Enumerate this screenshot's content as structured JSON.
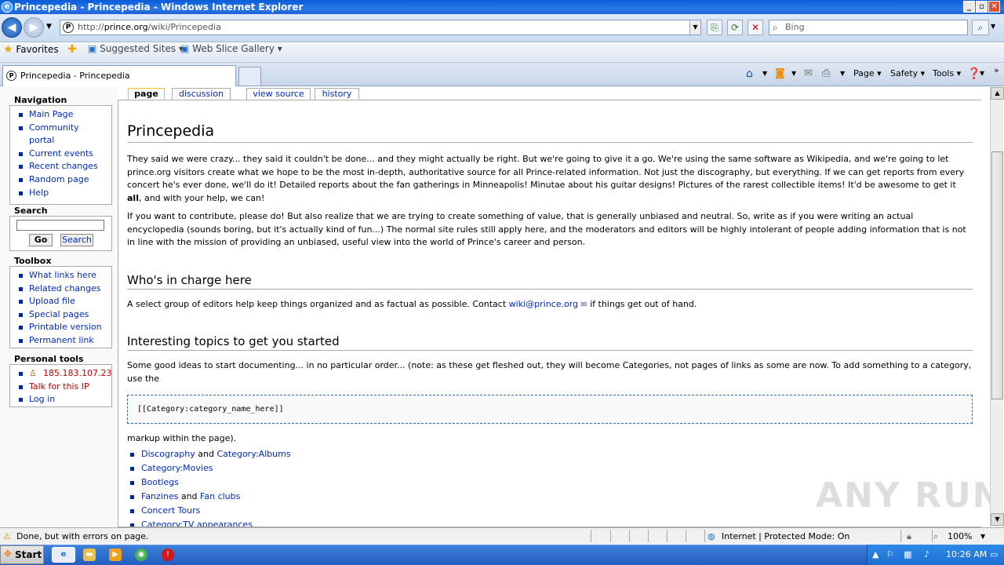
{
  "window": {
    "title": "Princepedia - Princepedia - Windows Internet Explorer"
  },
  "address": {
    "prefix": "http://",
    "host": "prince.org",
    "path": "/wiki/Princepedia"
  },
  "search": {
    "placeholder": "Bing"
  },
  "favorites": {
    "label": "Favorites",
    "items": [
      "Suggested Sites",
      "Web Slice Gallery"
    ]
  },
  "tab": {
    "title": "Princepedia - Princepedia"
  },
  "commands": {
    "page": "Page",
    "safety": "Safety",
    "tools": "Tools"
  },
  "content_tabs": [
    "page",
    "discussion",
    "view source",
    "history"
  ],
  "sidebar": {
    "navigation": {
      "title": "Navigation",
      "items": [
        "Main Page",
        "Community",
        "portal",
        "Current events",
        "Recent changes",
        "Random page",
        "Help"
      ]
    },
    "search": {
      "title": "Search",
      "go": "Go",
      "search": "Search"
    },
    "toolbox": {
      "title": "Toolbox",
      "items": [
        "What links here",
        "Related changes",
        "Upload file",
        "Special pages",
        "Printable version",
        "Permanent link"
      ]
    },
    "personal": {
      "title": "Personal tools",
      "items": [
        "185.183.107.23",
        "Talk for this IP",
        "Log in"
      ]
    }
  },
  "article": {
    "title": "Princepedia",
    "p1a": "They said we were crazy... they said it couldn't be done... and they might actually be right. But we're going to give it a go. We're using the same software as Wikipedia, and we're going to let prince.org visitors create what we hope to be the most in-depth, authoritative source for all Prince-related information. Not just the discography, but everything. If we can get reports from every concert he's ever done, we'll do it! Detailed reports about the fan gatherings in Minneapolis! Minutae about his guitar designs! Pictures of the rarest collectible items! It'd be awesome to get it ",
    "p1b": "all",
    "p1c": ", and with your help, we can!",
    "p2": "If you want to contribute, please do! But also realize that we are trying to create something of value, that is generally unbiased and neutral. So, write as if you were writing an actual encyclopedia (sounds boring, but it's actually kind of fun...) The normal site rules still apply here, and the moderators and editors will be highly intolerant of people adding information that is not in line with the mission of providing an unbiased, useful view into the world of Prince's career and person.",
    "h2a": "Who's in charge here",
    "p3a": "A select group of editors help keep things organized and as factual as possible. Contact ",
    "p3link": "wiki@prince.org",
    "p3b": " if things get out of hand.",
    "h2b": "Interesting topics to get you started",
    "p4": "Some good ideas to start documenting... in no particular order... (note: as these get fleshed out, they will become Categories, not pages of links as some are now. To add something to a category, use the",
    "pre": "[[Category:category_name_here]]",
    "p5": "markup within the page).",
    "topics": [
      {
        "a": "Discography",
        "and": " and ",
        "b": "Category:Albums"
      },
      {
        "a": "Category:Movies"
      },
      {
        "a": "Bootlegs"
      },
      {
        "a": "Fanzines",
        "and": " and ",
        "b": "Fan clubs"
      },
      {
        "a": "Concert Tours"
      },
      {
        "a": "Category:TV appearances"
      }
    ]
  },
  "status": {
    "text": "Done, but with errors on page.",
    "zone": "Internet | Protected Mode: On",
    "zoom": "100%"
  },
  "taskbar": {
    "start": "Start",
    "clock": "10:26 AM"
  },
  "watermark": "ANY RUN"
}
